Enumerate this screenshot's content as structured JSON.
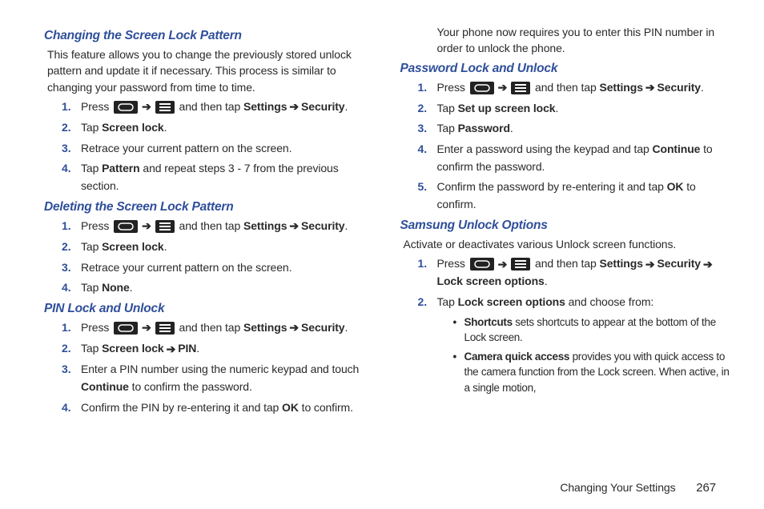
{
  "col1": {
    "s1": {
      "heading": "Changing the Screen Lock Pattern",
      "intro": "This feature allows you to change the previously stored unlock pattern and update it if necessary. This process is similar to changing your password from time to time.",
      "step1_a": "Press ",
      "step1_b": " and then tap ",
      "step1_settings": "Settings",
      "step1_security": "Security",
      "step1_end": ".",
      "step2_a": "Tap ",
      "step2_b": "Screen lock",
      "step2_c": ".",
      "step3": "Retrace your current pattern on the screen.",
      "step4_a": "Tap ",
      "step4_b": "Pattern",
      "step4_c": " and repeat steps 3 - 7 from the previous section."
    },
    "s2": {
      "heading": "Deleting the Screen Lock Pattern",
      "step1_a": "Press ",
      "step1_b": " and then tap ",
      "step1_settings": "Settings",
      "step1_security": "Security",
      "step1_end": ".",
      "step2_a": "Tap ",
      "step2_b": "Screen lock",
      "step2_c": ".",
      "step3": "Retrace your current pattern on the screen.",
      "step4_a": "Tap ",
      "step4_b": "None",
      "step4_c": "."
    },
    "s3": {
      "heading": "PIN Lock and Unlock",
      "step1_a": "Press ",
      "step1_b": " and then tap ",
      "step1_settings": "Settings",
      "step1_security": "Security",
      "step1_end": ".",
      "step2_a": "Tap ",
      "step2_b": "Screen lock",
      "step2_c": "PIN",
      "step2_d": ".",
      "step3_a": "Enter a PIN number using the numeric keypad and touch ",
      "step3_b": "Continue",
      "step3_c": " to confirm the password.",
      "step4_a": "Confirm the PIN by re-entering it and tap ",
      "step4_b": "OK",
      "step4_c": " to confirm."
    }
  },
  "col2": {
    "cont": "Your phone now requires you to enter this PIN number in order to unlock the phone.",
    "s4": {
      "heading": "Password Lock and Unlock",
      "step1_a": "Press ",
      "step1_b": " and then tap ",
      "step1_settings": "Settings",
      "step1_security": "Security",
      "step1_end": ".",
      "step2_a": "Tap ",
      "step2_b": "Set up screen lock",
      "step2_c": ".",
      "step3_a": "Tap ",
      "step3_b": "Password",
      "step3_c": ".",
      "step4_a": "Enter a password using the keypad and tap ",
      "step4_b": "Continue",
      "step4_c": " to confirm the password.",
      "step5_a": "Confirm the password by re-entering it and tap ",
      "step5_b": "OK",
      "step5_c": " to confirm."
    },
    "s5": {
      "heading": "Samsung Unlock Options",
      "intro": "Activate or deactivates various Unlock screen functions.",
      "step1_a": "Press ",
      "step1_b": " and then tap ",
      "step1_settings": "Settings",
      "step1_security": "Security",
      "step1_lock": "Lock screen options",
      "step1_end": ".",
      "step2_a": "Tap ",
      "step2_b": "Lock screen options",
      "step2_c": " and choose from:",
      "b1_a": "Shortcuts",
      "b1_b": " sets shortcuts to appear at the bottom of the Lock screen.",
      "b2_a": "Camera quick access",
      "b2_b": " provides you with quick access to the camera function from the Lock screen. When active, in a single motion,"
    }
  },
  "footer": {
    "text": "Changing Your Settings",
    "page": "267"
  },
  "arrow": "➔"
}
